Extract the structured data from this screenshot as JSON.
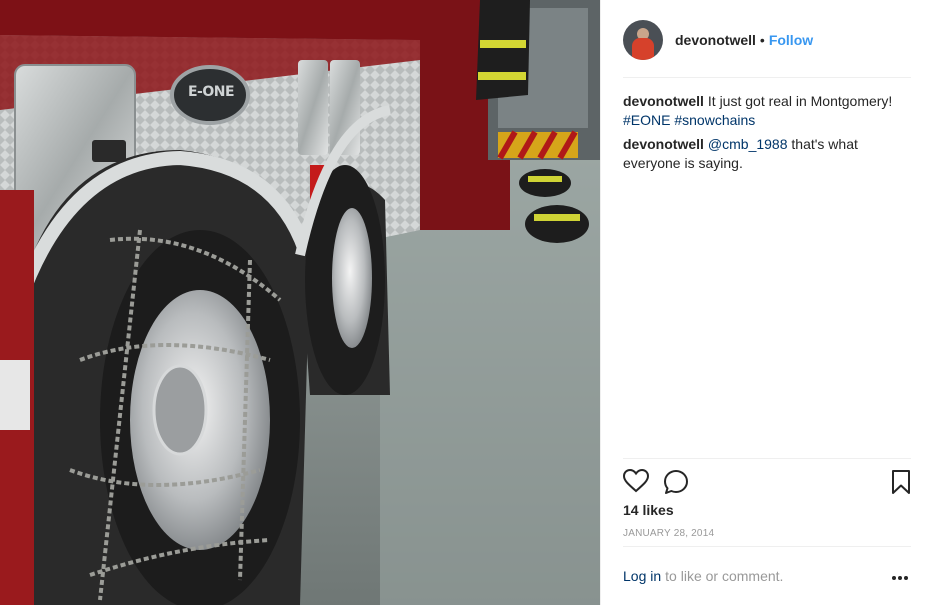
{
  "post": {
    "username": "devonotwell",
    "separator": "•",
    "follow_label": "Follow",
    "comments": [
      {
        "user": "devonotwell",
        "text": "It just got real in Montgomery!",
        "tags": [
          "#EONE",
          "#snowchains"
        ]
      },
      {
        "user": "devonotwell",
        "mention": "@cmb_1988",
        "text": "that's what everyone is saying."
      }
    ],
    "likes": "14 likes",
    "date": "JANUARY 28, 2014",
    "login_link": "Log in",
    "login_rest": "to like or comment.",
    "photo_badge_text": "E-ONE"
  },
  "icons": [
    "heart-icon",
    "comment-icon",
    "bookmark-icon",
    "more-options-icon"
  ],
  "colors": {
    "accent": "#3897f0",
    "link": "#003569",
    "muted": "#999999",
    "text": "#262626"
  }
}
